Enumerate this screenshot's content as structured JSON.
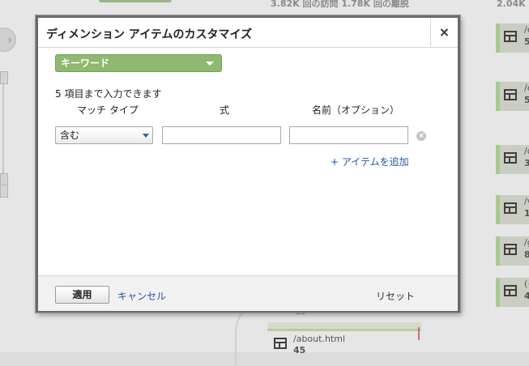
{
  "background": {
    "stats_text": "3.82K 回の訪問 1.78K 回の離脱",
    "stats_right": "2.04K 回",
    "nav_icon": "chevron-right-icon",
    "nodes": [
      {
        "label": "/e",
        "value": "5"
      },
      {
        "label": "/e",
        "value": "5"
      },
      {
        "label": "/d",
        "value": "3"
      },
      {
        "label": "/v",
        "value": "1"
      },
      {
        "label": "/g",
        "value": "8"
      },
      {
        "label": "(+",
        "value": "4"
      }
    ],
    "bottom_node": {
      "label": "/about.html",
      "value": "45"
    },
    "small_value": "15"
  },
  "modal": {
    "title": "ディメンション アイテムのカスタマイズ",
    "close_label": "×",
    "dimension": {
      "selected": "キーワード"
    },
    "limit_note": "5 項目まで入力できます",
    "columns": {
      "match_type": "マッチ タイプ",
      "expression": "式",
      "name": "名前（オプション）"
    },
    "row": {
      "match_type": "含む",
      "expression_value": "",
      "name_value": "",
      "remove_label": "×"
    },
    "add_item_label": "+ アイテムを追加",
    "footer": {
      "apply_label": "適用",
      "cancel_label": "キャンセル",
      "reset_label": "リセット"
    }
  },
  "colors": {
    "accent_green": "#8fb870",
    "link_blue": "#2255aa",
    "border_dark": "#6a6a6a"
  }
}
